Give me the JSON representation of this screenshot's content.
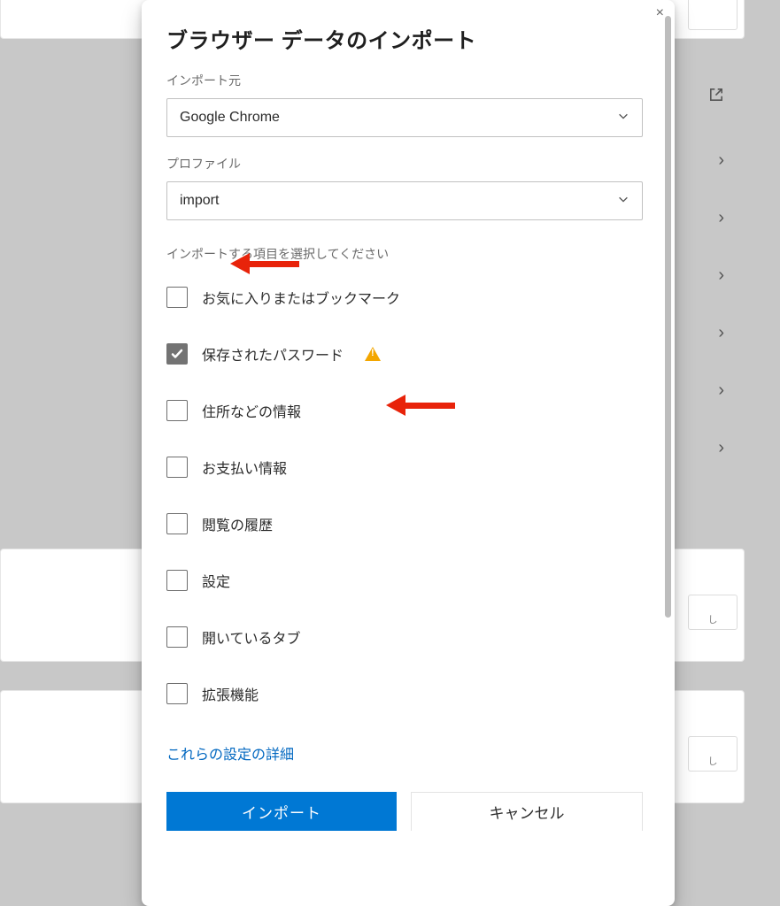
{
  "modal": {
    "title": "ブラウザー データのインポート",
    "close_label": "×",
    "source_label": "インポート元",
    "source_value": "Google Chrome",
    "profile_label": "プロファイル",
    "profile_value": "import",
    "section_label": "インポートする項目を選択してください",
    "items": [
      {
        "label": "お気に入りまたはブックマーク",
        "checked": false,
        "warn": false
      },
      {
        "label": "保存されたパスワード",
        "checked": true,
        "warn": true
      },
      {
        "label": "住所などの情報",
        "checked": false,
        "warn": false
      },
      {
        "label": "お支払い情報",
        "checked": false,
        "warn": false
      },
      {
        "label": "閲覧の履歴",
        "checked": false,
        "warn": false
      },
      {
        "label": "設定",
        "checked": false,
        "warn": false
      },
      {
        "label": "開いているタブ",
        "checked": false,
        "warn": false
      },
      {
        "label": "拡張機能",
        "checked": false,
        "warn": false
      }
    ],
    "details_link": "これらの設定の詳細",
    "import_button": "インポート",
    "cancel_button": "キャンセル"
  }
}
